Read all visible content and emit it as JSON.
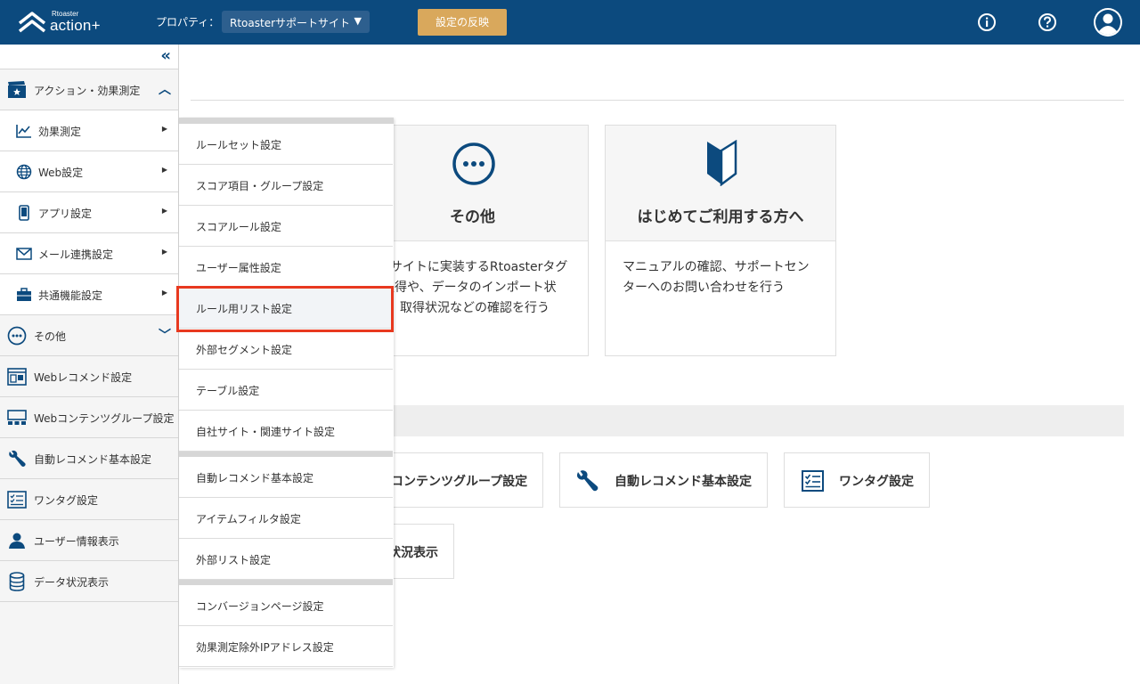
{
  "header": {
    "logo_small": "Rtoaster",
    "logo_main": "action+",
    "property_label": "プロパティ：",
    "property_value": "Rtoasterサポートサイト",
    "apply_button": "設定の反映",
    "icons": [
      "info-icon",
      "help-icon",
      "user-avatar-icon"
    ],
    "brand_color": "#0c4a7e",
    "accent_color": "#d9a85c"
  },
  "sidebar": {
    "collapse_icon": "double-chevron-left-icon",
    "items": [
      {
        "label": "アクション・効果測定",
        "icon": "clapperboard-star-icon",
        "expand": "up"
      },
      {
        "label": "効果測定",
        "icon": "line-chart-icon",
        "sub": true
      },
      {
        "label": "Web設定",
        "icon": "globe-icon",
        "sub": true
      },
      {
        "label": "アプリ設定",
        "icon": "smartphone-icon",
        "sub": true
      },
      {
        "label": "メール連携設定",
        "icon": "mail-icon",
        "sub": true
      },
      {
        "label": "共通機能設定",
        "icon": "briefcase-icon",
        "sub": true
      },
      {
        "label": "その他",
        "icon": "more-circle-icon",
        "expand": "down"
      },
      {
        "label": "Webレコメンド設定",
        "icon": "web-recommend-icon"
      },
      {
        "label": "Webコンテンツグループ設定",
        "icon": "content-group-icon"
      },
      {
        "label": "自動レコメンド基本設定",
        "icon": "wrench-icon"
      },
      {
        "label": "ワンタグ設定",
        "icon": "checklist-icon"
      },
      {
        "label": "ユーザー情報表示",
        "icon": "user-icon"
      },
      {
        "label": "データ状況表示",
        "icon": "database-icon"
      }
    ]
  },
  "dropdown": {
    "groups": [
      [
        "ルールセット設定",
        "スコア項目・グループ設定",
        "スコアルール設定",
        "ユーザー属性設定",
        "ルール用リスト設定",
        "外部セグメント設定",
        "テーブル設定",
        "自社サイト・関連サイト設定"
      ],
      [
        "自動レコメンド基本設定",
        "アイテムフィルタ設定",
        "外部リスト設定"
      ],
      [
        "コンバージョンページ設定",
        "効果測定除外IPアドレス設定"
      ]
    ],
    "highlighted": "ルール用リスト設定",
    "highlight_color": "#e8391f"
  },
  "cards": [
    {
      "title": "その他",
      "icon": "more-circle-icon",
      "desc_lines": [
        "bサイトに実装するRtoasterタグ",
        "取得や、データのインポート状",
        "取得状況などの確認を行う"
      ]
    },
    {
      "title": "はじめてご利用する方へ",
      "icon": "beginner-mark-icon",
      "desc_lines": [
        "マニュアルの確認、サポートセン",
        "ターへのお問い合わせを行う"
      ]
    }
  ],
  "shortcuts": [
    {
      "label": "コンテンツグループ設定",
      "icon": ""
    },
    {
      "label": "自動レコメンド基本設定",
      "icon": "wrench-icon"
    },
    {
      "label": "ワンタグ設定",
      "icon": "checklist-icon"
    },
    {
      "label": "状況表示",
      "icon": ""
    }
  ]
}
